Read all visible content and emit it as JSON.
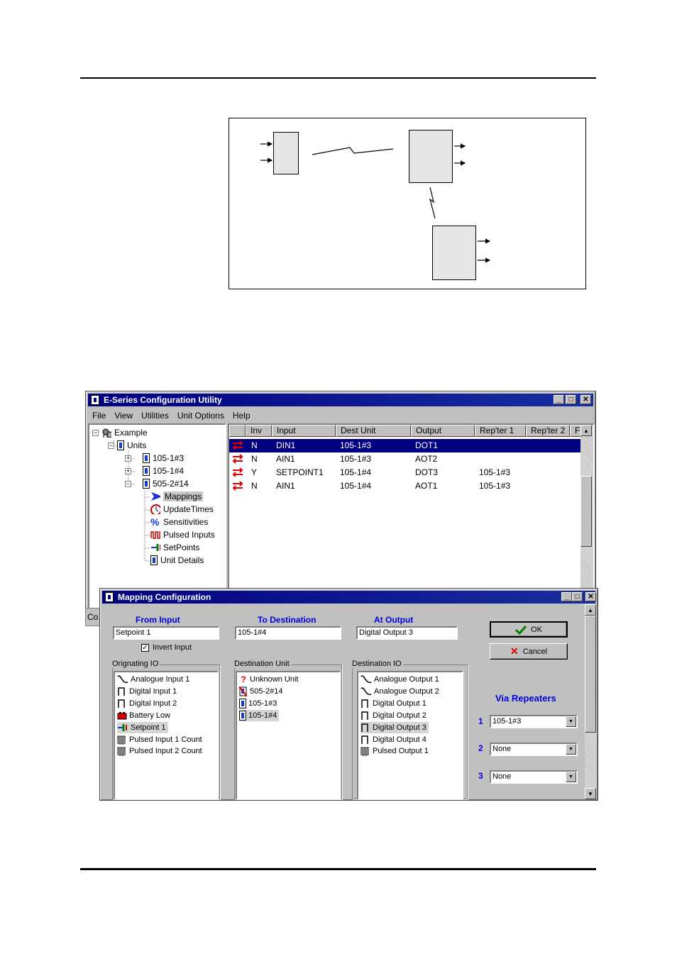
{
  "main_window": {
    "title": "E-Series Configuration Utility",
    "menu": [
      "File",
      "View",
      "Utilities",
      "Unit Options",
      "Help"
    ],
    "tree": {
      "root": "Example",
      "units": "Units",
      "unit_items": [
        "105-1#3",
        "105-1#4",
        "505-2#14"
      ],
      "sub_items": [
        "Mappings",
        "UpdateTimes",
        "Sensitivities",
        "Pulsed Inputs",
        "SetPoints",
        "Unit Details"
      ]
    },
    "columns": [
      "Inv",
      "Input",
      "Dest Unit",
      "Output",
      "Rep'ter 1",
      "Rep'ter 2",
      "F"
    ],
    "rows": [
      {
        "inv": "N",
        "input": "DIN1",
        "dest": "105-1#3",
        "output": "DOT1",
        "rep1": ""
      },
      {
        "inv": "N",
        "input": "AIN1",
        "dest": "105-1#3",
        "output": "AOT2",
        "rep1": ""
      },
      {
        "inv": "Y",
        "input": "SETPOINT1",
        "dest": "105-1#4",
        "output": "DOT3",
        "rep1": "105-1#3"
      },
      {
        "inv": "N",
        "input": "AIN1",
        "dest": "105-1#4",
        "output": "AOT1",
        "rep1": "105-1#3"
      }
    ],
    "status_fragment": "Co"
  },
  "dialog": {
    "title": "Mapping Configuration",
    "from_label": "From   Input",
    "to_label": "To Destination",
    "at_label": "At    Output",
    "from_value": "Setpoint 1",
    "to_value": "105-1#4",
    "at_value": "Digital Output 3",
    "invert_label": "Invert Input",
    "originating_title": "Orignating IO",
    "originating_items": [
      "Analogue Input 1",
      "Digital Input 1",
      "Digital Input 2",
      "Battery Low",
      "Setpoint 1",
      "Pulsed Input 1 Count",
      "Pulsed Input 2 Count"
    ],
    "dest_unit_title": "Destination Unit",
    "dest_unit_items": [
      "Unknown Unit",
      "505-2#14",
      "105-1#3",
      "105-1#4"
    ],
    "dest_io_title": "Destination IO",
    "dest_io_items": [
      "Analogue Output 1",
      "Analogue Output 2",
      "Digital Output 1",
      "Digital Output 2",
      "Digital Output 3",
      "Digital Output 4",
      "Pulsed Output 1"
    ],
    "ok_label": "OK",
    "cancel_label": "Cancel",
    "via_label": "Via Repeaters",
    "repeaters": [
      {
        "num": "1",
        "value": "105-1#3"
      },
      {
        "num": "2",
        "value": "None"
      },
      {
        "num": "3",
        "value": "None"
      }
    ]
  },
  "colors": {
    "title_bar": "#000080",
    "selection": "#000080",
    "dialog_labels": "#0000e0",
    "mapping_arrows": "#e00000"
  }
}
